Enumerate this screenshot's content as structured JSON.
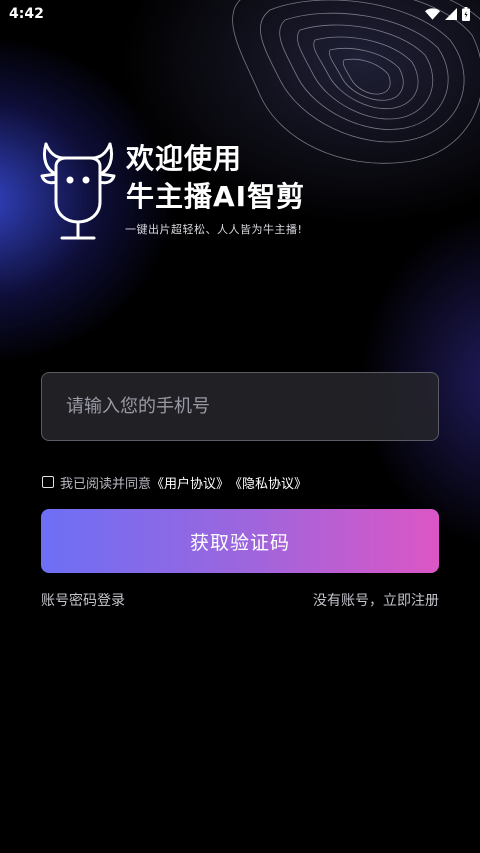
{
  "status_bar": {
    "time": "4:42"
  },
  "hero": {
    "title_line1": "欢迎使用",
    "title_line2": "牛主播AI智剪",
    "tagline": "一键出片超轻松、人人皆为牛主播!"
  },
  "form": {
    "phone_placeholder": "请输入您的手机号",
    "phone_value": "",
    "agreement_prefix": "我已阅读并同意",
    "user_agreement": "《用户协议》",
    "privacy_agreement": "《隐私协议》",
    "get_code_label": "获取验证码",
    "checkbox_checked": false
  },
  "footer": {
    "password_login": "账号密码登录",
    "register": "没有账号，立即注册"
  },
  "colors": {
    "button_gradient_start": "#6d6ff5",
    "button_gradient_end": "#dc56c5",
    "background": "#000000"
  }
}
